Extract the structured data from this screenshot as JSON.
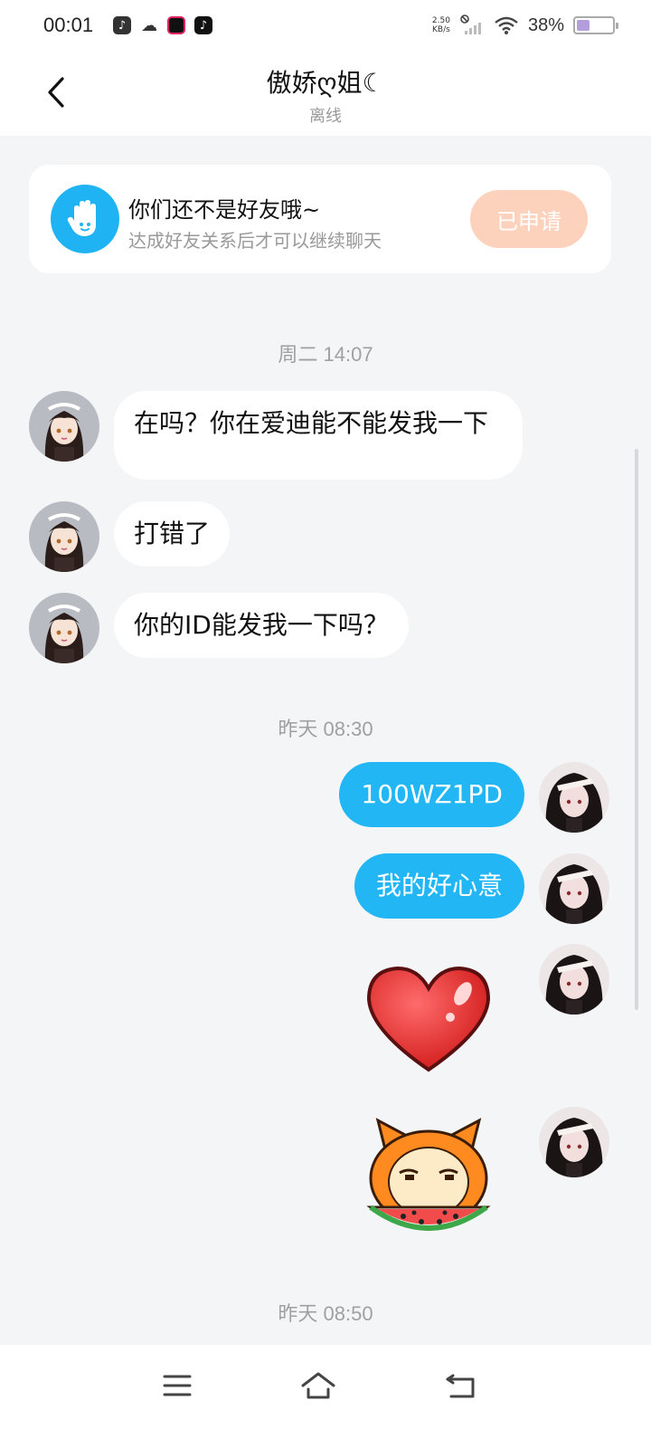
{
  "status_bar": {
    "time": "00:01",
    "net_speed_value": "2.50",
    "net_speed_unit": "KB/s",
    "battery_percent": "38%",
    "battery_level": 0.38,
    "app_icons": [
      "music-app-icon",
      "wechat-icon",
      "video-app-icon",
      "tiktok-icon"
    ]
  },
  "header": {
    "title": "傲娇ღ姐☾",
    "status": "离线"
  },
  "friend_card": {
    "title": "你们还不是好友哦~",
    "subtitle": "达成好友关系后才可以继续聊天",
    "button_label": "已申请"
  },
  "conversation": [
    {
      "type": "timestamp",
      "text": "周二 14:07"
    },
    {
      "type": "message",
      "direction": "in",
      "text": "在吗？你在爱迪能不能发我一下"
    },
    {
      "type": "message",
      "direction": "in",
      "text": "打错了"
    },
    {
      "type": "message",
      "direction": "in",
      "text": "你的ID能发我一下吗？"
    },
    {
      "type": "timestamp",
      "text": "昨天 08:30"
    },
    {
      "type": "message",
      "direction": "out",
      "text": "100WZ1PD"
    },
    {
      "type": "message",
      "direction": "out",
      "text": "我的好心意"
    },
    {
      "type": "sticker",
      "direction": "out",
      "sticker": "heart-sticker"
    },
    {
      "type": "sticker",
      "direction": "out",
      "sticker": "watermelon-cat-sticker"
    },
    {
      "type": "timestamp",
      "text": "昨天 08:50"
    }
  ],
  "colors": {
    "outgoing_bubble": "#22b6f5",
    "incoming_bubble": "#ffffff",
    "applied_button": "#fdd2bd",
    "hand_badge": "#1fb3f3",
    "background": "#f4f5f7"
  },
  "nav_bar": {
    "icons": [
      "menu-icon",
      "home-icon",
      "back-return-icon"
    ]
  }
}
